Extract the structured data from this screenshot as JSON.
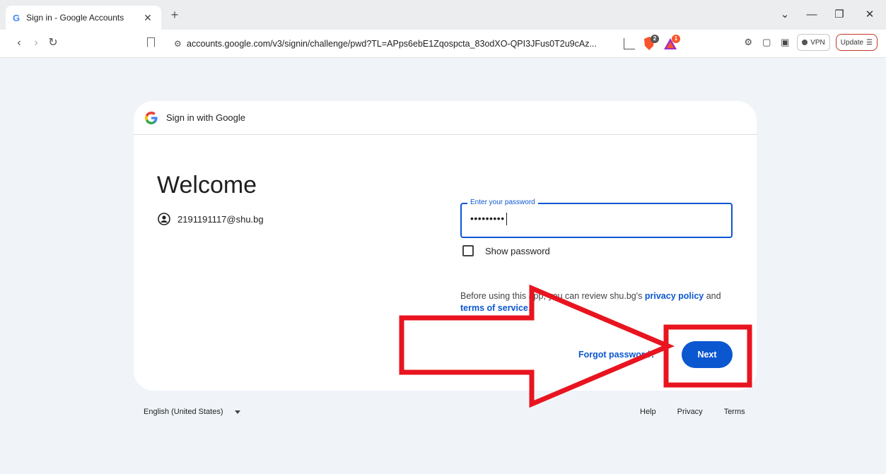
{
  "browser": {
    "tab_title": "Sign in - Google Accounts",
    "tab_close": "✕",
    "new_tab": "+",
    "url": "accounts.google.com/v3/signin/challenge/pwd?TL=APps6ebE1Zqospcta_83odXO-QPI3JFus0T2u9cAz...",
    "vpn_label": "VPN",
    "update_label": "Update",
    "brave_badge": "2",
    "rewards_badge": "1",
    "glyphs": {
      "back": "‹",
      "forward": "›",
      "reload": "↻",
      "site_settings": "⚙",
      "chevron_down": "⌄",
      "minimize": "—",
      "restore": "❐",
      "close": "✕",
      "extensions": "⚙",
      "sidebar": "▢",
      "wallet": "▣",
      "menu": "☰"
    }
  },
  "card": {
    "header_text": "Sign in with Google",
    "welcome": "Welcome",
    "account_email": "2191191117@shu.bg",
    "password_label": "Enter your password",
    "password_value": "•••••••••",
    "show_password_label": "Show password",
    "review_prefix": "Before using this app, you can review shu.bg's ",
    "privacy_policy": "privacy policy",
    "review_and": " and ",
    "terms_of_service": "terms of service",
    "review_suffix": ".",
    "forgot_password": "Forgot password?",
    "next_label": "Next"
  },
  "footer": {
    "language": "English (United States)",
    "links": [
      "Help",
      "Privacy",
      "Terms"
    ]
  },
  "colors": {
    "accent": "#0b57d0",
    "annotation_red": "#e8141f",
    "page_bg": "#f0f4f9"
  }
}
